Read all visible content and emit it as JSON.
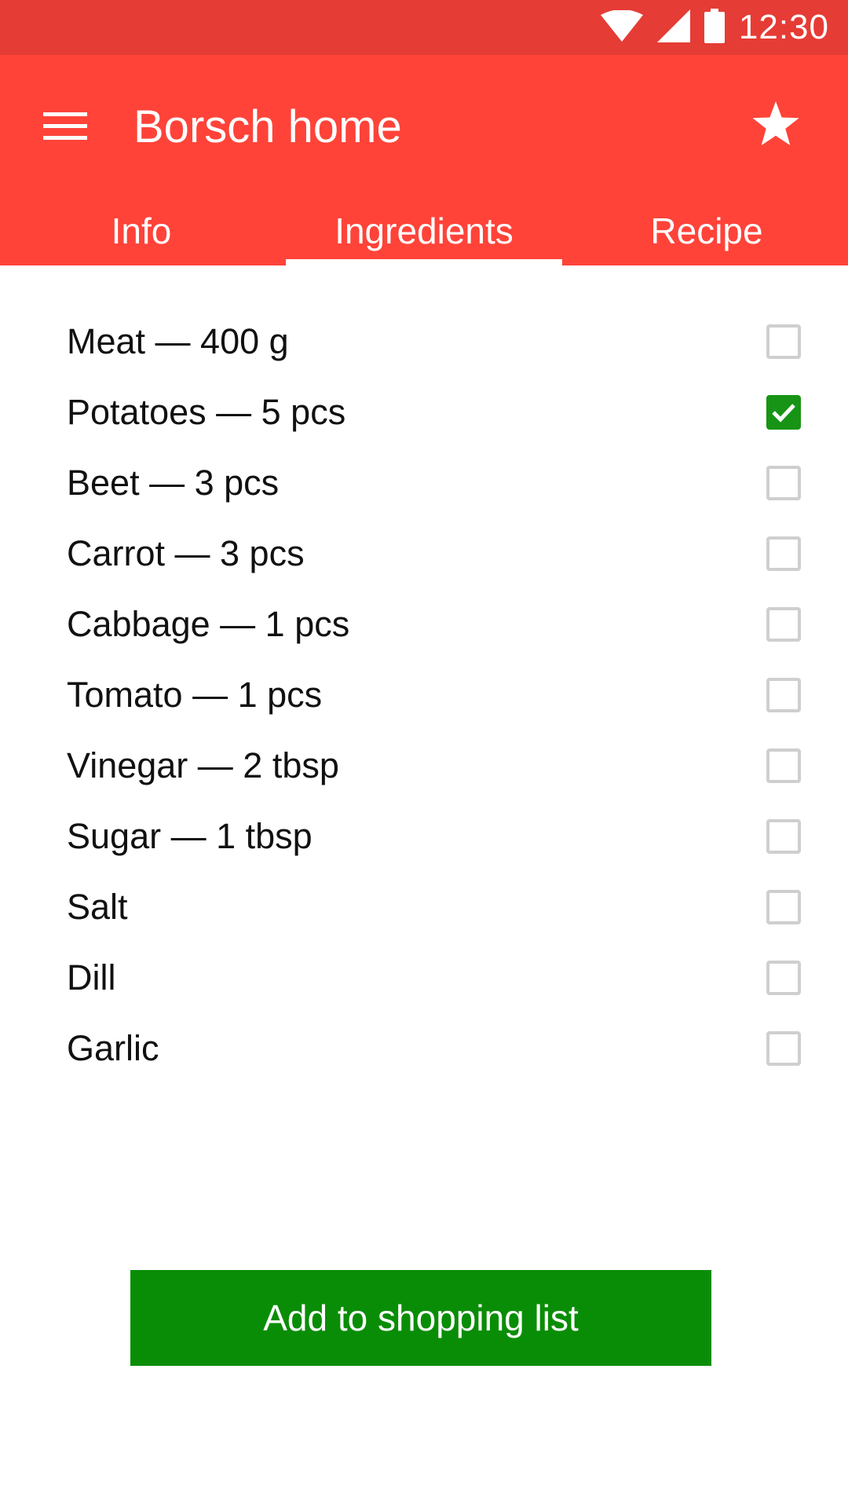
{
  "status_bar": {
    "time": "12:30",
    "icons": [
      "wifi-icon",
      "cellular-signal-icon",
      "battery-icon"
    ]
  },
  "app_bar": {
    "title": "Borsch home",
    "menu_icon": "hamburger-menu-icon",
    "favorite_icon": "star-icon"
  },
  "tabs": [
    {
      "label": "Info",
      "active": false
    },
    {
      "label": "Ingredients",
      "active": true
    },
    {
      "label": "Recipe",
      "active": false
    }
  ],
  "ingredients": [
    {
      "label": "Meat — 400 g",
      "checked": false
    },
    {
      "label": "Potatoes — 5 pcs",
      "checked": true
    },
    {
      "label": "Beet — 3 pcs",
      "checked": false
    },
    {
      "label": "Carrot — 3 pcs",
      "checked": false
    },
    {
      "label": "Cabbage — 1 pcs",
      "checked": false
    },
    {
      "label": "Tomato — 1 pcs",
      "checked": false
    },
    {
      "label": "Vinegar — 2 tbsp",
      "checked": false
    },
    {
      "label": "Sugar — 1 tbsp",
      "checked": false
    },
    {
      "label": "Salt",
      "checked": false
    },
    {
      "label": "Dill",
      "checked": false
    },
    {
      "label": "Garlic",
      "checked": false
    }
  ],
  "actions": {
    "add_to_shopping_list": "Add to shopping list"
  },
  "colors": {
    "status_bar": "#e53c35",
    "app_bar": "#ff4339",
    "checked_checkbox": "#179415",
    "cta_button": "#0a8d06"
  }
}
